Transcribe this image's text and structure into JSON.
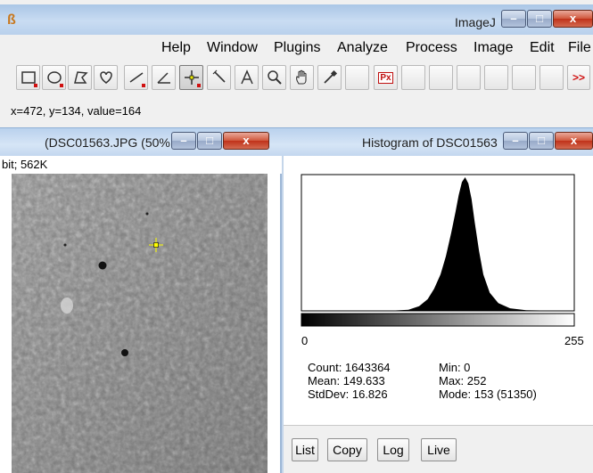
{
  "main_window": {
    "title": "ImageJ",
    "menus": [
      "Help",
      "Window",
      "Plugins",
      "Analyze",
      "Process",
      "Image",
      "Edit",
      "File"
    ],
    "toolbar": {
      "tools": [
        "rectangle",
        "oval",
        "polygon",
        "freehand",
        "straight-line",
        "angle",
        "point",
        "wand",
        "text",
        "magnifier",
        "hand",
        "color-picker"
      ],
      "active_tool": "point",
      "px_label": "Px",
      "more_label": ">>"
    },
    "status": "x=472, y=134, value=164"
  },
  "image_window": {
    "title": "(DSC01563.JPG (50%",
    "info": "bit; 562K"
  },
  "histogram_window": {
    "title": "Histogram of DSC01563",
    "axis_min_label": "0",
    "axis_max_label": "255",
    "stats": {
      "count": "Count: 1643364",
      "mean": "Mean: 149.633",
      "stddev": "StdDev: 16.826",
      "min": "Min: 0",
      "max": "Max: 252",
      "mode": "Mode: 153 (51350)"
    },
    "buttons": {
      "list": "List",
      "copy": "Copy",
      "log": "Log",
      "live": "Live"
    }
  },
  "chart_data": {
    "type": "area",
    "title": "Histogram of DSC01563",
    "xlim": [
      0,
      255
    ],
    "mean": 149.633,
    "stddev": 16.826,
    "mode": 153,
    "mode_count": 51350,
    "count": 1643364,
    "x": [
      0,
      80,
      100,
      110,
      118,
      124,
      130,
      135,
      140,
      144,
      147,
      150,
      153,
      156,
      159,
      162,
      166,
      170,
      176,
      184,
      195,
      210,
      252,
      255
    ],
    "values": [
      0,
      0,
      400,
      1800,
      4500,
      8500,
      14000,
      21000,
      30000,
      38000,
      44500,
      49500,
      51350,
      49000,
      43000,
      34000,
      23000,
      14000,
      7000,
      3000,
      1000,
      250,
      0,
      0
    ]
  },
  "colors": {
    "title_bar": "#c9dcf2",
    "close_button": "#c0321a",
    "window_bg": "#f0f0f0",
    "status_point_marker": "#ffff00"
  }
}
